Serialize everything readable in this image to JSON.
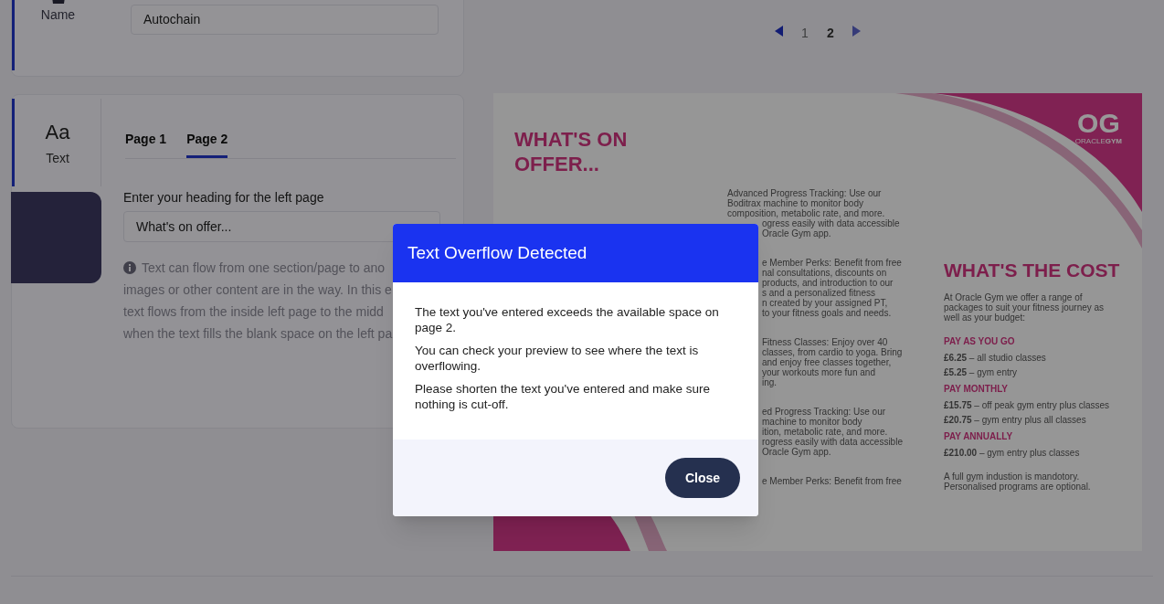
{
  "name_section": {
    "label": "Name",
    "value": "Autochain"
  },
  "pagination": {
    "pages": [
      {
        "label": "1",
        "selected": false
      },
      {
        "label": "2",
        "selected": true
      }
    ]
  },
  "text_section": {
    "nav": {
      "icon_text": "Aa",
      "label": "Text",
      "selected": true
    },
    "tabs": [
      {
        "label": "Page 1",
        "selected": false
      },
      {
        "label": "Page 2",
        "selected": true
      }
    ],
    "field_label": "Enter your heading for the left page",
    "field_value": "What's on offer...",
    "info_lines": [
      "Text can flow from one section/page to ano",
      "images or other content are in the way. In this e",
      "text flows from the inside left page to the midd",
      "when the text fills the blank space on the left pa"
    ]
  },
  "brochure": {
    "heading": "WHAT'S ON OFFER...",
    "logo_mark": "OG",
    "logo_name": "ORACLE**GYM**",
    "offer_paragraphs": [
      [
        {
          "text": "Advanced Progress Tracking: Use our",
          "kind": "full"
        },
        {
          "text": "Boditrax machine to monitor body",
          "kind": "full"
        },
        {
          "text": "composition, metabolic rate, and more.",
          "kind": "full"
        },
        {
          "text": "ogress easily with data accessible",
          "kind": "cut"
        },
        {
          "text": "Oracle Gym app.",
          "kind": "cut"
        }
      ],
      [
        {
          "text": "e Member Perks: Benefit from free",
          "kind": "cut"
        },
        {
          "text": "nal consultations, discounts on",
          "kind": "cut"
        },
        {
          "text": "products, and introduction to our",
          "kind": "cut"
        },
        {
          "text": "s and a personalized fitness",
          "kind": "cut"
        },
        {
          "text": "n created by your assigned PT,",
          "kind": "cut"
        },
        {
          "text": "to your fitness goals and needs.",
          "kind": "cut"
        }
      ],
      [
        {
          "text": "Fitness Classes: Enjoy over 40",
          "kind": "cut"
        },
        {
          "text": "classes, from cardio to yoga. Bring",
          "kind": "cut"
        },
        {
          "text": "and enjoy free classes together,",
          "kind": "cut"
        },
        {
          "text": "your workouts more fun and",
          "kind": "cut"
        },
        {
          "text": "ing.",
          "kind": "cut"
        }
      ],
      [
        {
          "text": "ed Progress Tracking: Use our",
          "kind": "cut"
        },
        {
          "text": "machine to monitor body",
          "kind": "cut"
        },
        {
          "text": "ition, metabolic rate, and more.",
          "kind": "cut"
        },
        {
          "text": "rogress easily with data accessible",
          "kind": "cut"
        },
        {
          "text": "Oracle Gym app.",
          "kind": "cut"
        }
      ],
      [
        {
          "text": "e Member Perks: Benefit from free",
          "kind": "cut"
        }
      ]
    ],
    "cost_heading": "WHAT'S THE COST",
    "cost_intro": "At Oracle Gym we offer a range of packages to suit your fitness journey as well as your budget:",
    "plans": [
      {
        "title": "PAY AS YOU GO",
        "prices": [
          "**£6.25** – all studio classes",
          "**£5.25** – gym entry"
        ]
      },
      {
        "title": "PAY MONTHLY",
        "prices": [
          "**£15.75** – off peak gym entry plus classes",
          "**£20.75** – gym entry plus all classes"
        ]
      },
      {
        "title": "PAY ANNUALLY",
        "prices": [
          "**£210.00** – gym entry plus classes"
        ]
      }
    ],
    "note": "A full gym industion is mandotory. Personalised programs are optional."
  },
  "dialog": {
    "title": "Text Overflow Detected",
    "paragraphs": [
      "The text you've entered exceeds the available space on page 2.",
      "You can check your preview to see where the text is overflowing.",
      "Please shorten the text you've entered and make sure nothing is cut-off."
    ],
    "button": "Close"
  }
}
